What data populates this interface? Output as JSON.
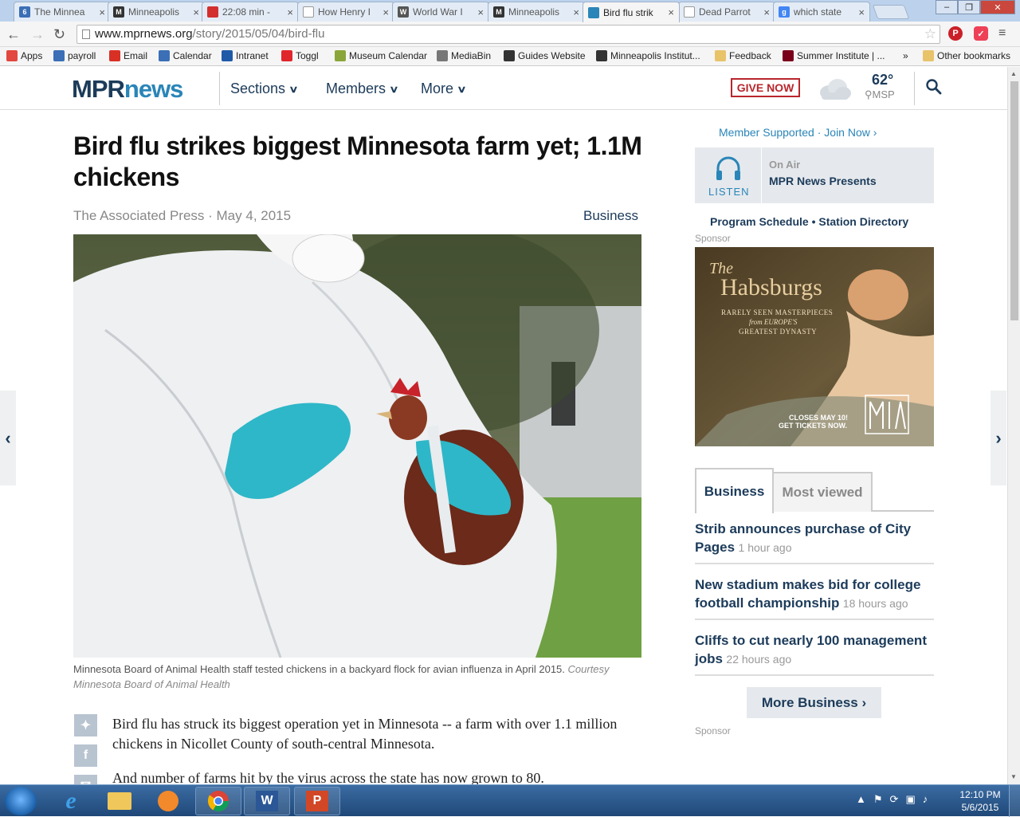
{
  "browser": {
    "tabs": [
      {
        "label": "The Minnea",
        "fav": "6",
        "fav_color": "#3b6fb6"
      },
      {
        "label": "Minneapolis",
        "fav": "M",
        "fav_color": "#333333"
      },
      {
        "label": "22:08 min - ",
        "fav": "",
        "fav_color": "#d32f2f"
      },
      {
        "label": "How Henry I",
        "fav": "",
        "fav_color": "#ffffff"
      },
      {
        "label": "World War I",
        "fav": "W",
        "fav_color": "#555555"
      },
      {
        "label": "Minneapolis",
        "fav": "M",
        "fav_color": "#333333"
      },
      {
        "label": "Bird flu strik",
        "fav": "",
        "fav_color": "#2a85b8"
      },
      {
        "label": "Dead Parrot",
        "fav": "",
        "fav_color": "#ffffff"
      },
      {
        "label": "which state",
        "fav": "g",
        "fav_color": "#4285f4"
      }
    ],
    "url_host": "www.mprnews.org",
    "url_path": "/story/2015/05/04/bird-flu",
    "bookmarks": [
      {
        "label": "Apps",
        "icon": "apps-icon",
        "color": "#e2483f"
      },
      {
        "label": "payroll",
        "icon": "payroll-icon",
        "color": "#3b6fb6"
      },
      {
        "label": "Email",
        "icon": "gmail-icon",
        "color": "#d93025"
      },
      {
        "label": "Calendar",
        "icon": "calendar-icon",
        "color": "#3b6fb6"
      },
      {
        "label": "Intranet",
        "icon": "intranet-icon",
        "color": "#1e5aa8"
      },
      {
        "label": "Toggl",
        "icon": "toggl-icon",
        "color": "#e0262a"
      },
      {
        "label": "Museum Calendar",
        "icon": "museum-icon",
        "color": "#8aa63a"
      },
      {
        "label": "MediaBin",
        "icon": "mediabin-icon",
        "color": "#777777"
      },
      {
        "label": "Guides Website",
        "icon": "guides-icon",
        "color": "#333333"
      },
      {
        "label": "Minneapolis Institut...",
        "icon": "mia-icon",
        "color": "#333333"
      },
      {
        "label": "Feedback",
        "icon": "folder-icon",
        "color": "#e8c36a"
      },
      {
        "label": "Summer Institute | ...",
        "icon": "umn-icon",
        "color": "#7a0019"
      }
    ],
    "more_bookmarks": "»",
    "other_bookmarks": "Other bookmarks"
  },
  "header": {
    "logo_mpr": "MPR",
    "logo_news": "news",
    "nav": [
      {
        "label": "Sections"
      },
      {
        "label": "Members"
      },
      {
        "label": "More"
      }
    ],
    "give_now": "GIVE NOW",
    "temperature": "62°",
    "location": "MSP"
  },
  "article": {
    "headline": "Bird flu strikes biggest Minnesota farm yet; 1.1M chickens",
    "byline": "The Associated Press · May 4, 2015",
    "category": "Business",
    "caption": "Minnesota Board of Animal Health staff tested chickens in a backyard flock for avian influenza in April 2015.",
    "caption_credit": "Courtesy Minnesota Board of Animal Health",
    "paragraphs": [
      "Bird flu has struck its biggest operation yet in Minnesota -- a farm with over 1.1 million chickens in Nicollet County of south-central Minnesota.",
      "And number of farms hit by the virus across the state has now grown to 80."
    ]
  },
  "sidebar": {
    "member_link": "Member Supported · Join Now",
    "listen_label": "LISTEN",
    "on_air_label": "On Air",
    "on_air_show": "MPR News Presents",
    "program_links": "Program Schedule • Station Directory",
    "sponsor_label": "Sponsor",
    "ad": {
      "title_small": "The",
      "title": "Habsburgs",
      "subtitle_1": "RARELY SEEN MASTERPIECES",
      "subtitle_2": "from EUROPE'S",
      "subtitle_3": "GREATEST DYNASTY",
      "cta_1": "CLOSES MAY 10!",
      "cta_2": "GET TICKETS NOW."
    },
    "tabs": [
      {
        "label": "Business"
      },
      {
        "label": "Most viewed"
      }
    ],
    "stories": [
      {
        "title": "Strib announces purchase of City Pages",
        "time": "1 hour ago"
      },
      {
        "title": "New stadium makes bid for college football championship",
        "time": "18 hours ago"
      },
      {
        "title": "Cliffs to cut nearly 100 management jobs",
        "time": "22 hours ago"
      }
    ],
    "more_business": "More Business"
  },
  "taskbar": {
    "time": "12:10 PM",
    "date": "5/6/2015"
  }
}
